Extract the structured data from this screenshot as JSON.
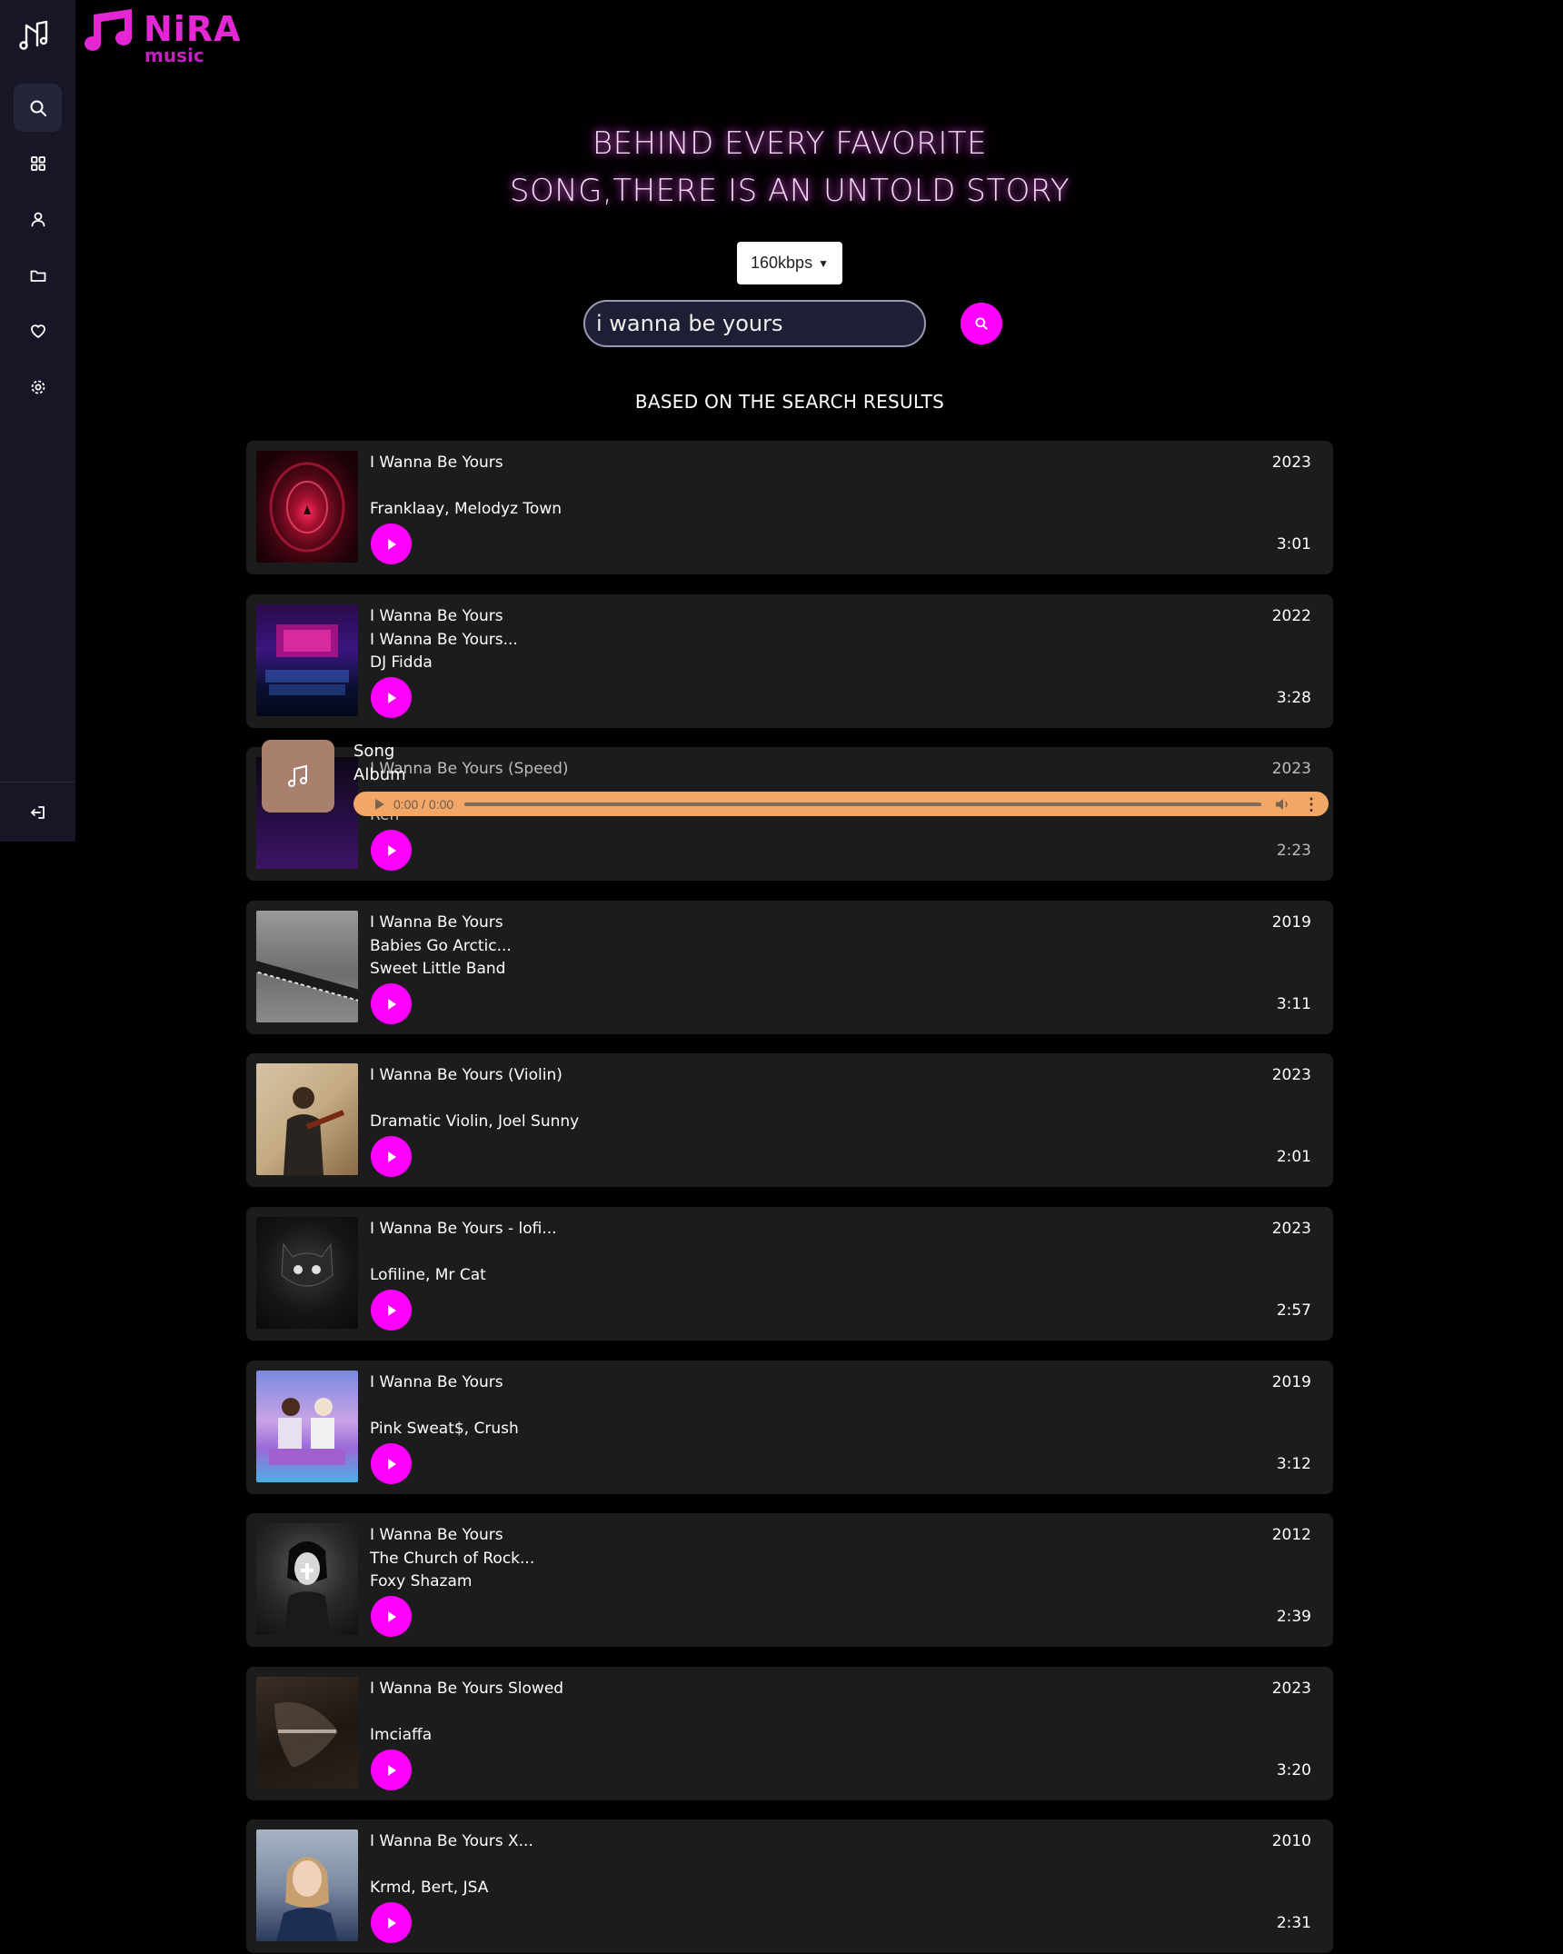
{
  "brand": {
    "name": "NiRA",
    "sub": "music"
  },
  "hero": {
    "line1": "BEHIND EVERY FAVORITE",
    "line2": "SONG,THERE IS AN UNTOLD STORY"
  },
  "bitrate": {
    "selected": "160kbps"
  },
  "search": {
    "value": "i wanna be yours"
  },
  "results_title": "BASED ON THE SEARCH RESULTS",
  "player": {
    "song": "Song",
    "album": "Album",
    "time": "0:00 / 0:00"
  },
  "results": [
    {
      "title": "I Wanna Be Yours",
      "album": "",
      "artist": "Franklaay, Melodyz Town",
      "year": "2023",
      "duration": "3:01"
    },
    {
      "title": "I Wanna Be Yours",
      "album": "I Wanna Be Yours...",
      "artist": "DJ Fidda",
      "year": "2022",
      "duration": "3:28"
    },
    {
      "title": "I Wanna Be Yours (Speed)",
      "album": "",
      "artist": "Ren",
      "year": "2023",
      "duration": "2:23"
    },
    {
      "title": "I Wanna Be Yours",
      "album": "Babies Go Arctic...",
      "artist": "Sweet Little Band",
      "year": "2019",
      "duration": "3:11"
    },
    {
      "title": "I Wanna Be Yours (Violin)",
      "album": "",
      "artist": "Dramatic Violin, Joel Sunny",
      "year": "2023",
      "duration": "2:01"
    },
    {
      "title": "I Wanna Be Yours - lofi...",
      "album": "",
      "artist": "Lofiline, Mr Cat",
      "year": "2023",
      "duration": "2:57"
    },
    {
      "title": "I Wanna Be Yours",
      "album": "",
      "artist": "Pink Sweat$, Crush",
      "year": "2019",
      "duration": "3:12"
    },
    {
      "title": "I Wanna Be Yours",
      "album": "The Church of Rock...",
      "artist": "Foxy Shazam",
      "year": "2012",
      "duration": "2:39"
    },
    {
      "title": "I Wanna Be Yours Slowed",
      "album": "",
      "artist": "Imciaffa",
      "year": "2023",
      "duration": "3:20"
    },
    {
      "title": "I Wanna Be Yours X...",
      "album": "",
      "artist": "Krmd, Bert, JSA",
      "year": "2010",
      "duration": "2:31"
    }
  ],
  "colors": {
    "accent": "#ff00ff",
    "brand": "#e327d4",
    "sidebar": "#161626",
    "card": "#1c1c1c",
    "player": "#f3a766"
  },
  "icons": [
    "search-icon",
    "grid-icon",
    "user-icon",
    "folder-icon",
    "heart-icon",
    "gear-icon",
    "logout-icon",
    "play-icon",
    "music-note-icon",
    "volume-icon",
    "more-icon"
  ]
}
